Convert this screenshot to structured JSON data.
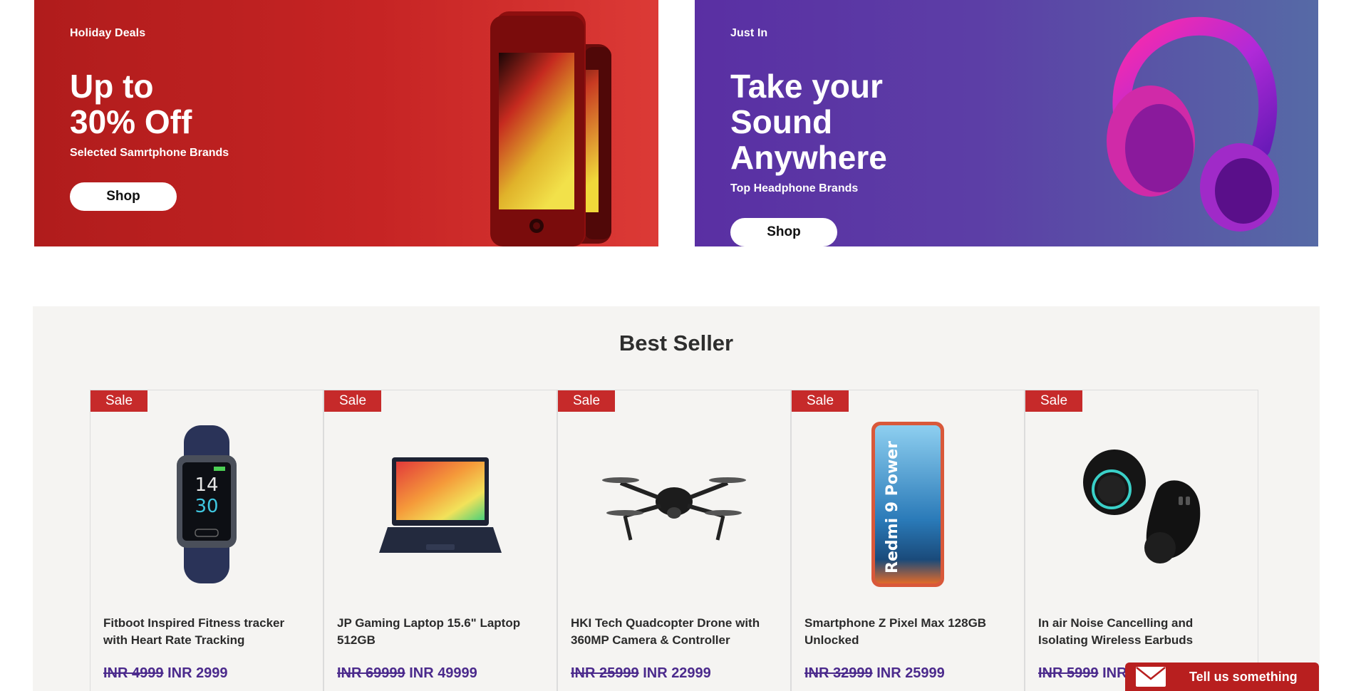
{
  "promos": [
    {
      "eyebrow": "Holiday Deals",
      "headline": "Up to\n30% Off",
      "subtitle": "Selected Samrtphone Brands",
      "button_label": "Shop",
      "art": "smartphone-illustration",
      "color": "#b01c1c"
    },
    {
      "eyebrow": "Just In",
      "headline": "Take your\nSound\nAnywhere",
      "subtitle": "Top Headphone Brands",
      "button_label": "Shop",
      "art": "headphones-illustration",
      "color": "#5a2fa3"
    }
  ],
  "bestseller": {
    "title": "Best Seller",
    "products": [
      {
        "badge": "Sale",
        "name": "Fitboot Inspired Fitness tracker with Heart Rate Tracking",
        "old_price": "INR 4999",
        "price": "INR 2999",
        "icon": "fitness-tracker-image"
      },
      {
        "badge": "Sale",
        "name": "JP Gaming Laptop 15.6\" Laptop 512GB",
        "old_price": "INR 69999",
        "price": "INR 49999",
        "icon": "laptop-image"
      },
      {
        "badge": "Sale",
        "name": "HKI Tech Quadcopter Drone with 360MP Camera & Controller",
        "old_price": "INR 25999",
        "price": "INR 22999",
        "icon": "drone-image"
      },
      {
        "badge": "Sale",
        "name": "Smartphone Z Pixel Max 128GB Unlocked",
        "old_price": "INR 32999",
        "price": "INR 25999",
        "icon": "smartphone-image"
      },
      {
        "badge": "Sale",
        "name": "In air Noise Cancelling and Isolating Wireless Earbuds",
        "old_price": "INR 5999",
        "price": "INR 3999",
        "icon": "earbuds-image"
      }
    ]
  },
  "feedback": {
    "label": "Tell us something",
    "icon": "envelope-icon"
  },
  "colors": {
    "sale": "#c62a2a",
    "price": "#4b2a8c",
    "section_bg": "#f5f4f2"
  }
}
